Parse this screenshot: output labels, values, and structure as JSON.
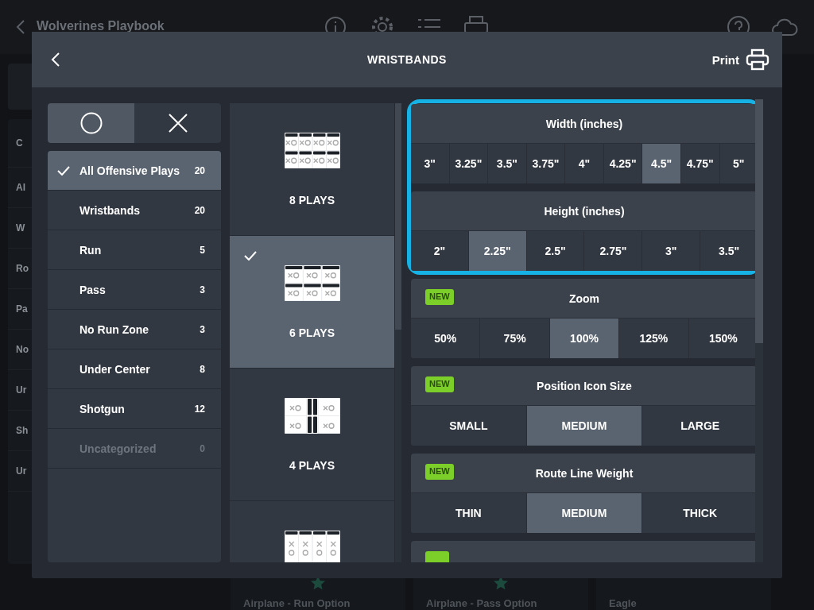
{
  "background": {
    "title": "Wolverines Playbook",
    "sidebar_items": [
      "C",
      "Al",
      "W",
      "Ro",
      "Pa",
      "No",
      "Ur",
      "Sh",
      "Ur"
    ],
    "cards": [
      {
        "title": "Airplane - Run Option",
        "starred": true
      },
      {
        "title": "Airplane - Pass Option",
        "starred": true
      },
      {
        "title": "Eagle",
        "starred": false
      }
    ]
  },
  "modal": {
    "title": "WRISTBANDS",
    "print_label": "Print"
  },
  "filter_toggles": [
    {
      "kind": "circle",
      "selected": true
    },
    {
      "kind": "cross",
      "selected": false
    }
  ],
  "categories": [
    {
      "label": "All Offensive Plays",
      "count": "20",
      "selected": true,
      "disabled": false
    },
    {
      "label": "Wristbands",
      "count": "20",
      "selected": false,
      "disabled": false
    },
    {
      "label": "Run",
      "count": "5",
      "selected": false,
      "disabled": false
    },
    {
      "label": "Pass",
      "count": "3",
      "selected": false,
      "disabled": false
    },
    {
      "label": "No Run Zone",
      "count": "3",
      "selected": false,
      "disabled": false
    },
    {
      "label": "Under Center",
      "count": "8",
      "selected": false,
      "disabled": false
    },
    {
      "label": "Shotgun",
      "count": "12",
      "selected": false,
      "disabled": false
    },
    {
      "label": "Uncategorized",
      "count": "0",
      "selected": false,
      "disabled": true
    }
  ],
  "layouts": [
    {
      "kind": "grid8",
      "label": "8 PLAYS",
      "selected": false
    },
    {
      "kind": "grid6",
      "label": "6 PLAYS",
      "selected": true
    },
    {
      "kind": "split4",
      "label": "4 PLAYS",
      "selected": false
    },
    {
      "kind": "columns4",
      "selected": false
    }
  ],
  "settings_groups": [
    {
      "highlighted": true,
      "sections": [
        {
          "title": "Width (inches)",
          "is_new": false,
          "options": [
            {
              "label": "3\"",
              "selected": false
            },
            {
              "label": "3.25\"",
              "selected": false
            },
            {
              "label": "3.5\"",
              "selected": false
            },
            {
              "label": "3.75\"",
              "selected": false
            },
            {
              "label": "4\"",
              "selected": false
            },
            {
              "label": "4.25\"",
              "selected": false
            },
            {
              "label": "4.5\"",
              "selected": true
            },
            {
              "label": "4.75\"",
              "selected": false
            },
            {
              "label": "5\"",
              "selected": false
            }
          ]
        },
        {
          "title": "Height (inches)",
          "is_new": false,
          "options": [
            {
              "label": "2\"",
              "selected": false
            },
            {
              "label": "2.25\"",
              "selected": true
            },
            {
              "label": "2.5\"",
              "selected": false
            },
            {
              "label": "2.75\"",
              "selected": false
            },
            {
              "label": "3\"",
              "selected": false
            },
            {
              "label": "3.5\"",
              "selected": false
            }
          ]
        }
      ]
    },
    {
      "highlighted": false,
      "sections": [
        {
          "title": "Zoom",
          "is_new": true,
          "new_label": "NEW",
          "options": [
            {
              "label": "50%",
              "selected": false
            },
            {
              "label": "75%",
              "selected": false
            },
            {
              "label": "100%",
              "selected": true
            },
            {
              "label": "125%",
              "selected": false
            },
            {
              "label": "150%",
              "selected": false
            }
          ]
        },
        {
          "title": "Position Icon Size",
          "is_new": true,
          "new_label": "NEW",
          "options": [
            {
              "label": "SMALL",
              "selected": false
            },
            {
              "label": "MEDIUM",
              "selected": true
            },
            {
              "label": "LARGE",
              "selected": false
            }
          ]
        },
        {
          "title": "Route Line Weight",
          "is_new": true,
          "new_label": "NEW",
          "options": [
            {
              "label": "THIN",
              "selected": false
            },
            {
              "label": "MEDIUM",
              "selected": true
            },
            {
              "label": "THICK",
              "selected": false
            }
          ]
        },
        {
          "is_new": true
        }
      ]
    }
  ]
}
